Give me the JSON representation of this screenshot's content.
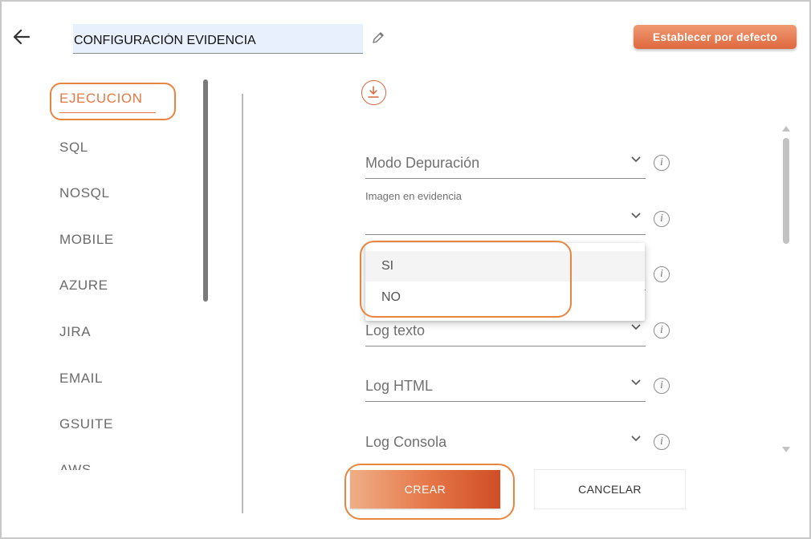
{
  "header": {
    "back_icon": "arrow-left-icon",
    "title_value": "CONFIGURACIÓN EVIDENCIA",
    "edit_icon": "pencil-icon",
    "default_button_label": "Establecer por defecto"
  },
  "sidebar": {
    "items": [
      {
        "label": "EJECUCION",
        "active": true
      },
      {
        "label": "SQL"
      },
      {
        "label": "NOSQL"
      },
      {
        "label": "MOBILE"
      },
      {
        "label": "AZURE"
      },
      {
        "label": "JIRA"
      },
      {
        "label": "EMAIL"
      },
      {
        "label": "GSUITE"
      },
      {
        "label": "AWS"
      }
    ]
  },
  "form": {
    "download_icon": "download-icon",
    "fields": [
      {
        "label": "Modo Depuración"
      },
      {
        "label": "Imagen en evidencia",
        "value": ""
      },
      {
        "label": "Log texto"
      },
      {
        "label": "Log HTML"
      },
      {
        "label": "Log Consola"
      }
    ],
    "dropdown_options": [
      "SI",
      "NO"
    ]
  },
  "actions": {
    "create_label": "CREAR",
    "cancel_label": "CANCELAR"
  },
  "colors": {
    "accent": "#e07a45",
    "highlight_ring": "#e8853f",
    "input_bg": "#e8f0fe"
  }
}
